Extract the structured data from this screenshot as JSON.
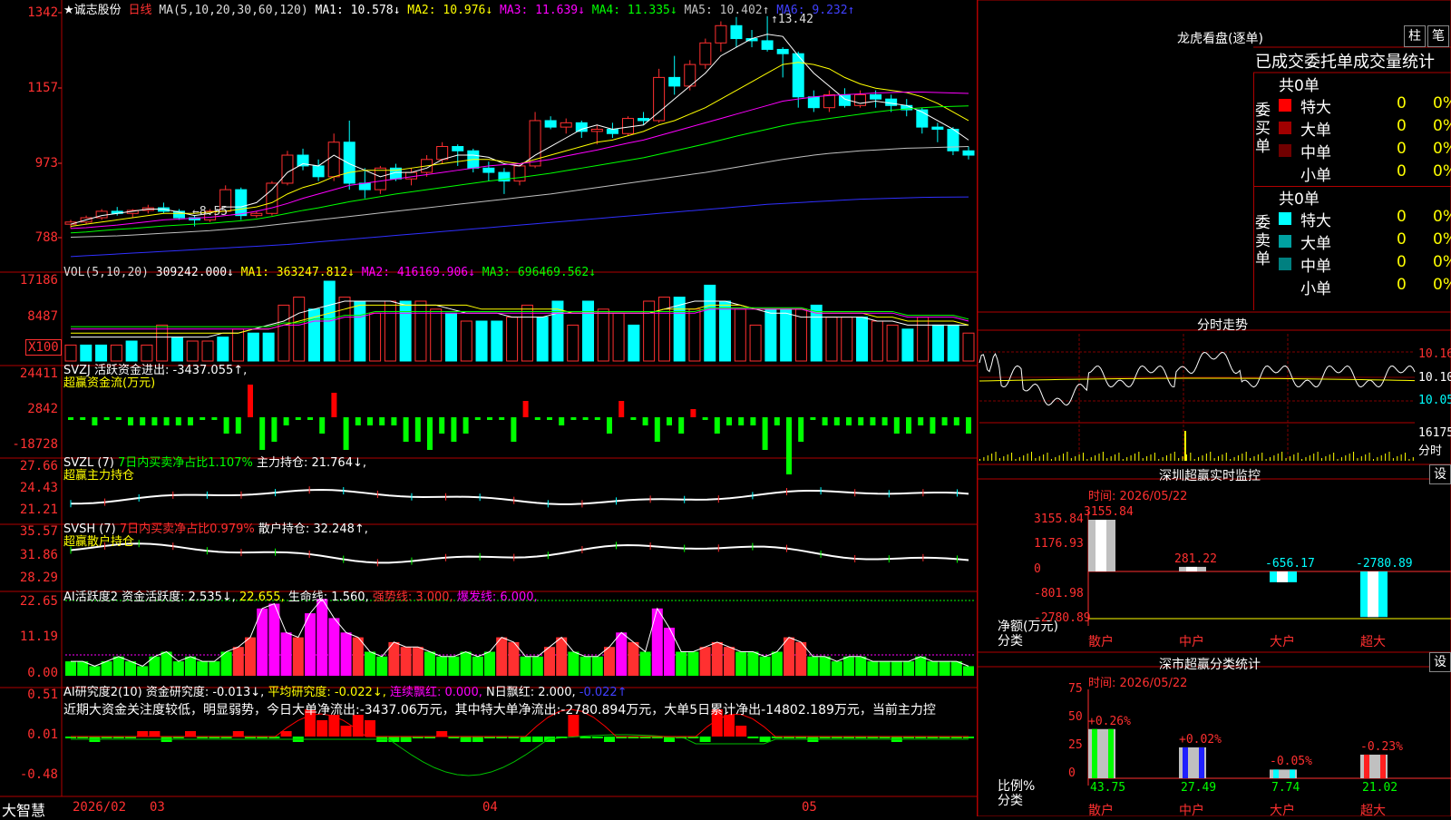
{
  "stock": {
    "name": "★诚志股份",
    "period": "日线"
  },
  "main": {
    "ma_title": "MA(5,10,20,30,60,120)",
    "ma": [
      {
        "label": "MA1: 10.578↓",
        "color": "#ffffff"
      },
      {
        "label": "MA2: 10.976↓",
        "color": "#ffff00"
      },
      {
        "label": "MA3: 11.639↓",
        "color": "#ff00ff"
      },
      {
        "label": "MA4: 11.335↓",
        "color": "#00ff00"
      },
      {
        "label": "MA5: 10.402↑",
        "color": "#c0c0c0"
      },
      {
        "label": "MA6: 9.232↑",
        "color": "#4040ff"
      }
    ],
    "y_ticks": [
      "1342",
      "1157",
      "973",
      "788"
    ],
    "high_mark": "13.42",
    "low_mark": "8.55",
    "price_range": [
      7.7,
      13.5
    ],
    "candles": [
      [
        8.6,
        8.7,
        8.5,
        8.65
      ],
      [
        8.65,
        8.8,
        8.6,
        8.75
      ],
      [
        8.75,
        8.95,
        8.7,
        8.9
      ],
      [
        8.9,
        9.0,
        8.8,
        8.85
      ],
      [
        8.85,
        8.95,
        8.75,
        8.92
      ],
      [
        8.92,
        9.05,
        8.85,
        8.98
      ],
      [
        8.98,
        9.1,
        8.85,
        8.9
      ],
      [
        8.9,
        8.95,
        8.7,
        8.75
      ],
      [
        8.75,
        8.8,
        8.55,
        8.7
      ],
      [
        8.7,
        8.95,
        8.65,
        8.9
      ],
      [
        8.9,
        9.5,
        8.85,
        9.4
      ],
      [
        9.4,
        9.45,
        8.7,
        8.8
      ],
      [
        8.8,
        8.9,
        8.75,
        8.85
      ],
      [
        8.85,
        9.6,
        8.8,
        9.55
      ],
      [
        9.55,
        10.3,
        9.5,
        10.2
      ],
      [
        10.2,
        10.35,
        9.85,
        9.95
      ],
      [
        9.95,
        10.1,
        9.6,
        9.7
      ],
      [
        9.7,
        10.7,
        9.6,
        10.5
      ],
      [
        10.5,
        11.0,
        9.4,
        9.55
      ],
      [
        9.55,
        9.9,
        9.2,
        9.4
      ],
      [
        9.4,
        9.95,
        9.3,
        9.9
      ],
      [
        9.9,
        10.0,
        9.6,
        9.65
      ],
      [
        9.65,
        9.9,
        9.5,
        9.8
      ],
      [
        9.8,
        10.2,
        9.7,
        10.1
      ],
      [
        10.1,
        10.5,
        10.0,
        10.4
      ],
      [
        10.4,
        10.45,
        9.95,
        10.3
      ],
      [
        10.3,
        10.35,
        9.8,
        9.9
      ],
      [
        9.9,
        10.05,
        9.6,
        9.8
      ],
      [
        9.8,
        9.9,
        9.3,
        9.6
      ],
      [
        9.6,
        10.0,
        9.5,
        9.95
      ],
      [
        9.95,
        11.2,
        9.9,
        11.0
      ],
      [
        11.0,
        11.1,
        10.8,
        10.85
      ],
      [
        10.85,
        11.05,
        10.7,
        10.95
      ],
      [
        10.95,
        11.0,
        10.6,
        10.75
      ],
      [
        10.75,
        10.9,
        10.45,
        10.8
      ],
      [
        10.8,
        10.95,
        10.6,
        10.7
      ],
      [
        10.7,
        11.1,
        10.65,
        11.05
      ],
      [
        11.05,
        11.2,
        10.9,
        11.0
      ],
      [
        11.0,
        12.2,
        10.95,
        12.0
      ],
      [
        12.0,
        12.5,
        11.6,
        11.8
      ],
      [
        11.8,
        12.4,
        11.7,
        12.3
      ],
      [
        12.3,
        12.9,
        12.2,
        12.8
      ],
      [
        12.8,
        13.3,
        12.6,
        13.2
      ],
      [
        13.2,
        13.4,
        12.7,
        12.9
      ],
      [
        12.9,
        13.1,
        12.7,
        12.85
      ],
      [
        12.85,
        13.42,
        12.6,
        12.65
      ],
      [
        12.65,
        12.7,
        12.0,
        12.55
      ],
      [
        12.55,
        12.6,
        11.3,
        11.55
      ],
      [
        11.55,
        11.7,
        11.2,
        11.3
      ],
      [
        11.3,
        11.7,
        11.2,
        11.6
      ],
      [
        11.6,
        11.75,
        11.3,
        11.35
      ],
      [
        11.35,
        11.7,
        11.3,
        11.6
      ],
      [
        11.6,
        11.7,
        11.3,
        11.5
      ],
      [
        11.5,
        11.6,
        11.2,
        11.35
      ],
      [
        11.35,
        11.5,
        11.1,
        11.25
      ],
      [
        11.25,
        11.3,
        10.7,
        10.85
      ],
      [
        10.85,
        10.95,
        10.5,
        10.8
      ],
      [
        10.8,
        10.85,
        10.2,
        10.3
      ],
      [
        10.3,
        10.4,
        10.1,
        10.2
      ]
    ],
    "ma1": [
      8.6,
      8.7,
      8.8,
      8.85,
      8.9,
      8.95,
      8.95,
      8.88,
      8.8,
      8.85,
      9.0,
      9.0,
      9.1,
      9.4,
      9.8,
      10.0,
      9.95,
      10.2,
      10.0,
      9.85,
      9.7,
      9.8,
      9.8,
      9.9,
      10.1,
      10.2,
      10.2,
      10.15,
      10.0,
      9.95,
      10.2,
      10.4,
      10.6,
      10.8,
      10.9,
      10.8,
      10.85,
      10.9,
      11.2,
      11.5,
      11.8,
      12.1,
      12.5,
      12.7,
      12.9,
      13.0,
      12.95,
      12.5,
      12.1,
      11.8,
      11.5,
      11.4,
      11.45,
      11.4,
      11.35,
      11.2,
      11.0,
      10.8,
      10.55
    ],
    "ma2": [
      8.55,
      8.6,
      8.65,
      8.7,
      8.75,
      8.8,
      8.85,
      8.85,
      8.85,
      8.88,
      8.9,
      8.95,
      9.0,
      9.1,
      9.3,
      9.45,
      9.55,
      9.7,
      9.8,
      9.85,
      9.85,
      9.85,
      9.9,
      9.95,
      10.0,
      10.05,
      10.1,
      10.1,
      10.05,
      10.0,
      10.1,
      10.2,
      10.3,
      10.4,
      10.5,
      10.55,
      10.65,
      10.75,
      10.9,
      11.0,
      11.15,
      11.3,
      11.5,
      11.7,
      11.9,
      12.1,
      12.3,
      12.35,
      12.3,
      12.2,
      12.0,
      11.85,
      11.75,
      11.7,
      11.65,
      11.55,
      11.4,
      11.2,
      11.0
    ],
    "ma3": [
      8.5,
      8.52,
      8.55,
      8.58,
      8.62,
      8.66,
      8.7,
      8.72,
      8.74,
      8.76,
      8.8,
      8.84,
      8.9,
      8.98,
      9.08,
      9.2,
      9.3,
      9.4,
      9.5,
      9.55,
      9.6,
      9.65,
      9.7,
      9.75,
      9.8,
      9.85,
      9.9,
      9.95,
      9.98,
      10.0,
      10.05,
      10.1,
      10.18,
      10.25,
      10.32,
      10.4,
      10.48,
      10.55,
      10.65,
      10.75,
      10.85,
      10.95,
      11.05,
      11.15,
      11.25,
      11.35,
      11.45,
      11.5,
      11.55,
      11.58,
      11.6,
      11.62,
      11.64,
      11.65,
      11.66,
      11.66,
      11.65,
      11.64,
      11.63
    ],
    "ma4": [
      8.4,
      8.42,
      8.45,
      8.48,
      8.5,
      8.53,
      8.56,
      8.58,
      8.6,
      8.62,
      8.65,
      8.68,
      8.72,
      8.78,
      8.85,
      8.92,
      8.98,
      9.05,
      9.12,
      9.18,
      9.24,
      9.3,
      9.35,
      9.4,
      9.45,
      9.5,
      9.55,
      9.6,
      9.64,
      9.68,
      9.73,
      9.78,
      9.84,
      9.9,
      9.96,
      10.02,
      10.08,
      10.14,
      10.22,
      10.3,
      10.38,
      10.46,
      10.55,
      10.64,
      10.72,
      10.8,
      10.88,
      10.95,
      11.0,
      11.05,
      11.1,
      11.15,
      11.2,
      11.24,
      11.27,
      11.3,
      11.32,
      11.33,
      11.34
    ],
    "ma5": [
      8.3,
      8.31,
      8.32,
      8.33,
      8.35,
      8.37,
      8.39,
      8.41,
      8.43,
      8.45,
      8.48,
      8.51,
      8.54,
      8.58,
      8.62,
      8.66,
      8.7,
      8.74,
      8.78,
      8.82,
      8.86,
      8.9,
      8.94,
      8.98,
      9.02,
      9.06,
      9.1,
      9.14,
      9.18,
      9.22,
      9.26,
      9.3,
      9.35,
      9.4,
      9.45,
      9.5,
      9.55,
      9.6,
      9.65,
      9.7,
      9.75,
      9.8,
      9.86,
      9.92,
      9.98,
      10.04,
      10.1,
      10.15,
      10.2,
      10.24,
      10.27,
      10.3,
      10.32,
      10.34,
      10.36,
      10.37,
      10.38,
      10.39,
      10.4
    ],
    "ma6": [
      7.85,
      7.87,
      7.89,
      7.91,
      7.93,
      7.95,
      7.97,
      7.99,
      8.01,
      8.03,
      8.05,
      8.07,
      8.09,
      8.11,
      8.13,
      8.16,
      8.19,
      8.22,
      8.25,
      8.28,
      8.31,
      8.34,
      8.37,
      8.4,
      8.43,
      8.46,
      8.49,
      8.52,
      8.55,
      8.58,
      8.61,
      8.64,
      8.67,
      8.7,
      8.73,
      8.76,
      8.79,
      8.82,
      8.85,
      8.88,
      8.91,
      8.94,
      8.97,
      9.0,
      9.03,
      9.06,
      9.08,
      9.1,
      9.12,
      9.14,
      9.16,
      9.18,
      9.19,
      9.2,
      9.21,
      9.22,
      9.225,
      9.23,
      9.232
    ]
  },
  "vol": {
    "title": "VOL(5,10,20)",
    "v": "309242.000↓",
    "ma1": "MA1: 363247.812↓",
    "ma2": "MA2: 416169.906↓",
    "ma3": "MA3: 696469.562↓",
    "y_ticks": [
      "17186",
      "8487",
      "X100"
    ],
    "values": [
      4,
      4,
      4,
      4,
      5,
      4,
      9,
      6,
      5,
      5,
      6,
      8,
      7,
      7,
      14,
      16,
      13,
      20,
      16,
      15,
      12,
      15,
      15,
      15,
      13,
      12,
      10,
      10,
      10,
      11,
      14,
      11,
      15,
      9,
      15,
      13,
      12,
      9,
      15,
      16,
      16,
      13,
      19,
      15,
      13,
      9,
      13,
      13,
      13,
      14,
      11,
      11,
      11,
      10,
      9,
      8,
      11,
      9,
      9,
      7
    ],
    "ma_a": [
      6,
      6,
      6,
      6,
      6,
      6,
      6,
      6,
      6,
      6,
      7,
      7,
      8,
      9,
      10,
      12,
      13,
      14,
      15,
      15,
      15,
      15,
      14,
      14,
      14,
      13,
      12,
      12,
      12,
      11,
      11,
      11,
      12,
      12,
      12,
      12,
      12,
      12,
      12,
      13,
      14,
      15,
      15,
      15,
      14,
      13,
      12,
      12,
      11,
      11,
      11,
      11,
      11,
      10,
      10,
      9,
      9,
      9,
      9,
      9
    ],
    "ma_b": [
      7,
      7,
      7,
      7,
      7,
      7,
      7,
      7,
      7,
      7,
      7,
      7,
      8,
      8,
      9,
      10,
      11,
      12,
      13,
      14,
      14,
      14,
      14,
      14,
      14,
      14,
      14,
      13,
      13,
      13,
      13,
      13,
      13,
      12,
      12,
      12,
      12,
      12,
      12,
      13,
      13,
      13,
      14,
      14,
      14,
      13,
      13,
      13,
      13,
      12,
      12,
      12,
      12,
      11,
      11,
      10,
      10,
      10,
      10,
      9
    ],
    "ma_c": [
      8,
      8,
      8,
      8,
      8,
      8,
      8,
      8,
      8,
      8,
      8,
      8,
      8,
      8,
      9,
      9,
      10,
      10,
      11,
      11,
      12,
      12,
      12,
      12,
      12,
      12,
      12,
      12,
      12,
      12,
      12,
      12,
      12,
      12,
      12,
      12,
      12,
      12,
      12,
      12,
      12,
      12,
      13,
      13,
      13,
      13,
      13,
      13,
      13,
      12,
      12,
      12,
      12,
      12,
      12,
      11,
      11,
      11,
      11,
      10
    ]
  },
  "svzj": {
    "title": "SVZJ  活跃资金进出: -3437.055↑,",
    "sub": "超赢资金流(万元)",
    "y_ticks": [
      "24411",
      "2842",
      "-18728"
    ],
    "values": [
      0,
      0,
      -1,
      0,
      0,
      -1,
      -1,
      -1,
      -1,
      -1,
      -1,
      0,
      0,
      -2,
      -2,
      4,
      -4,
      -3,
      -1,
      0,
      0,
      -2,
      3,
      -4,
      -1,
      -1,
      -1,
      -1,
      -3,
      -3,
      -4,
      -2,
      -3,
      -2,
      0,
      0,
      0,
      -3,
      2,
      0,
      0,
      -1,
      0,
      0,
      0,
      -2,
      2,
      0,
      -1,
      -3,
      -1,
      -2,
      1,
      0,
      -2,
      -1,
      -1,
      -1,
      -4,
      -1,
      -7,
      -3,
      0,
      -1,
      -1,
      -1,
      -1,
      -1,
      -1,
      -2,
      -2,
      -1,
      -2,
      -1,
      -1,
      -2
    ]
  },
  "svzl": {
    "title": "SVZL (7)",
    "t2": "7日内买卖净占比1.107%",
    "t3": "主力持仓: 21.764↓,",
    "sub": "超赢主力持仓",
    "y_ticks": [
      "27.66",
      "24.43",
      "21.21"
    ]
  },
  "svsh": {
    "title": "SVSH (7)",
    "t2": "7日内买卖净占比0.979%",
    "t3": "散户持仓: 32.248↑,",
    "sub": "超赢散户持仓",
    "y_ticks": [
      "35.57",
      "31.86",
      "28.29"
    ]
  },
  "ai1": {
    "title": "AI活跃度2 资金活跃度: 2.535↓,",
    "t2": "22.655,",
    "t3": "生命线: 1.560,",
    "t4": "强势线: 3.000,",
    "t5": "爆发线: 6.000,",
    "y_ticks": [
      "22.65",
      "11.19",
      "0.00"
    ]
  },
  "ai2": {
    "title": "AI研究度2(10) 资金研究度: -0.013↓,",
    "t2": "平均研究度: -0.022↓,",
    "t3": "连续飘红: 0.000,",
    "t4": "N日飘红: 2.000,",
    "t5": "-0.022↑",
    "news": "近期大资金关注度较低，明显弱势，今日大单净流出:-3437.06万元，其中特大单净流出:-2780.894万元，大单5日累计净出-14802.189万元，当前主力控",
    "y_ticks": [
      "0.51",
      "0.01",
      "-0.48"
    ]
  },
  "xaxis": {
    "brand": "大智慧",
    "labels": [
      "2026/02",
      "03",
      "04",
      "05"
    ]
  },
  "right": {
    "lhb_title": "龙虎看盘(逐单)",
    "btn_zhu": "柱",
    "btn_bi": "笔",
    "stats_title": "已成交委托单成交量统计",
    "buy_side": "委买单",
    "sell_side": "委卖单",
    "buy_total": "共0单",
    "sell_total": "共0单",
    "buy_rows": [
      {
        "name": "特大",
        "v": "0",
        "p": "0%",
        "color": "#ff0000"
      },
      {
        "name": "大单",
        "v": "0",
        "p": "0%",
        "color": "#a00000"
      },
      {
        "name": "中单",
        "v": "0",
        "p": "0%",
        "color": "#700000"
      },
      {
        "name": "小单",
        "v": "0",
        "p": "0%",
        "color": ""
      }
    ],
    "sell_rows": [
      {
        "name": "特大",
        "v": "0",
        "p": "0%",
        "color": "#00ffff"
      },
      {
        "name": "大单",
        "v": "0",
        "p": "0%",
        "color": "#00a0a0"
      },
      {
        "name": "中单",
        "v": "0",
        "p": "0%",
        "color": "#008080"
      },
      {
        "name": "小单",
        "v": "0",
        "p": "0%",
        "color": ""
      }
    ],
    "intraday_title": "分时走势",
    "intraday_y": [
      "10.16",
      "10.10",
      "10.05"
    ],
    "intraday_vol": "16175",
    "intraday_vol_label": "分时",
    "sz_title": "深圳超赢实时监控",
    "sz_time": "时间: 2026/05/22",
    "sz_y": [
      "3155.84",
      "1176.93",
      "0",
      "-801.98",
      "-2780.89"
    ],
    "sz_axis_label": "净额(万元)",
    "sz_axis_label2": "分类",
    "sz_bars": [
      {
        "cat": "散户",
        "value": 3155.84,
        "label": "3155.84"
      },
      {
        "cat": "中户",
        "value": 281.22,
        "label": "281.22"
      },
      {
        "cat": "大户",
        "value": -656.17,
        "label": "-656.17"
      },
      {
        "cat": "超大",
        "value": -2780.89,
        "label": "-2780.89"
      }
    ],
    "sz_set": "设",
    "ss_title": "深市超赢分类统计",
    "ss_time": "时间: 2026/05/22",
    "ss_y": [
      "75",
      "50",
      "25",
      "0"
    ],
    "ss_axis_label": "比例%",
    "ss_axis_label2": "分类",
    "ss_bars": [
      {
        "cat": "散户",
        "value": 43.75,
        "label": "43.75",
        "chg": "+0.26%"
      },
      {
        "cat": "中户",
        "value": 27.49,
        "label": "27.49",
        "chg": "+0.02%"
      },
      {
        "cat": "大户",
        "value": 7.74,
        "label": "7.74",
        "chg": "-0.05%"
      },
      {
        "cat": "超大",
        "value": 21.02,
        "label": "21.02",
        "chg": "-0.23%"
      }
    ],
    "ss_set": "设"
  }
}
